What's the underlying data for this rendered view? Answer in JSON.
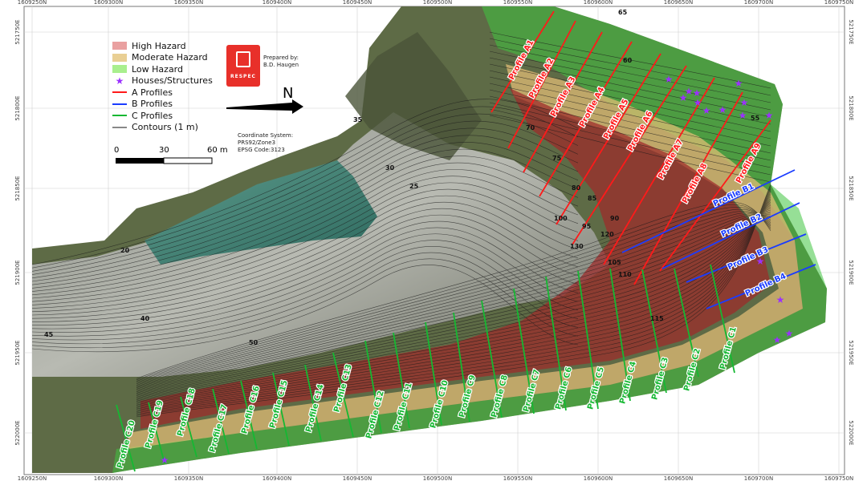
{
  "legend": {
    "items": [
      {
        "label": "High Hazard",
        "kind": "fill",
        "color": "#e9a0a0"
      },
      {
        "label": "Moderate Hazard",
        "kind": "fill",
        "color": "#e9cf94"
      },
      {
        "label": "Low Hazard",
        "kind": "fill",
        "color": "#a9ef8e"
      },
      {
        "label": "Houses/Structures",
        "kind": "star",
        "color": "#9b30ff"
      },
      {
        "label": "A Profiles",
        "kind": "line",
        "color": "#ff1a1a"
      },
      {
        "label": "B Profiles",
        "kind": "line",
        "color": "#1a3cff"
      },
      {
        "label": "C Profiles",
        "kind": "line",
        "color": "#15b832"
      },
      {
        "label": "Contours (1 m)",
        "kind": "line",
        "color": "#888888"
      }
    ]
  },
  "logo": {
    "brand": "RESPEC"
  },
  "prepared_by": {
    "line1": "Prepared by:",
    "line2": "B.D. Haugen"
  },
  "north_label": "N",
  "scale_bar": {
    "tick0": "0",
    "tick1": "30",
    "tick2": "60 m"
  },
  "coord_system": {
    "line1": "Coordinate System:",
    "line2": "PRS92/Zone3",
    "line3": "EPSG Code:3123"
  },
  "grid": {
    "top_ticks": [
      "1609250N",
      "1609300N",
      "1609350N",
      "1609400N",
      "1609450N",
      "1609500N",
      "1609550N",
      "1609600N",
      "1609650N",
      "1609700N",
      "1609750N"
    ],
    "bottom_ticks": [
      "1609250N",
      "1609300N",
      "1609350N",
      "1609400N",
      "1609450N",
      "1609500N",
      "1609550N",
      "1609600N",
      "1609650N",
      "1609700N",
      "1609750N"
    ],
    "left_ticks": [
      "521750E",
      "521800E",
      "521850E",
      "521900E",
      "521950E",
      "522000E"
    ],
    "right_ticks": [
      "521750E",
      "521800E",
      "521850E",
      "521900E",
      "521950E",
      "522000E"
    ]
  },
  "profiles_a": [
    "Profile A1",
    "Profile A2",
    "Profile A3",
    "Profile A4",
    "Profile A5",
    "Profile A6",
    "Profile A7",
    "Profile A8",
    "Profile A9"
  ],
  "profiles_b": [
    "Profile B1",
    "Profile B2",
    "Profile B3",
    "Profile B4"
  ],
  "profiles_c": [
    "Profile C1",
    "Profile C2",
    "Profile C3",
    "Profile C4",
    "Profile C5",
    "Profile C6",
    "Profile C7",
    "Profile C8",
    "Profile C9",
    "Profile C10",
    "Profile C11",
    "Profile C12",
    "Profile C13",
    "Profile C14",
    "Profile C15",
    "Profile C16",
    "Profile C17",
    "Profile C18",
    "Profile C19",
    "Profile C20"
  ],
  "contour_labels": [
    "65",
    "60",
    "55",
    "50",
    "45",
    "40",
    "35",
    "30",
    "25",
    "20",
    "70",
    "75",
    "80",
    "85",
    "90",
    "95",
    "100",
    "105",
    "110",
    "115",
    "120",
    "130"
  ]
}
